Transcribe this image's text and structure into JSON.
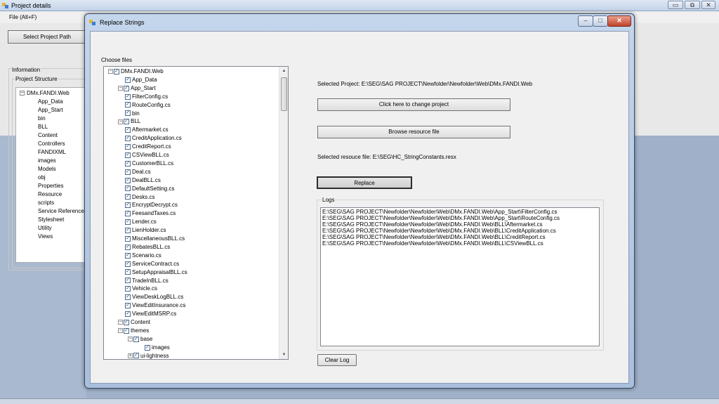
{
  "background_window": {
    "title": "Project details",
    "menu": "File (Alt+F)",
    "caption_buttons": {
      "minimize": "▭",
      "restore": "⧉",
      "close": "✕"
    },
    "select_path_label": "Select Project Path",
    "information_label": "Information",
    "project_structure_label": "Project Structure",
    "tree_root": "DMx.FANDI.Web",
    "tree_items": [
      "App_Data",
      "App_Start",
      "bin",
      "BLL",
      "Content",
      "Controllers",
      "FANDIXML",
      "images",
      "Models",
      "obj",
      "Properties",
      "Resource",
      "scripts",
      "Service Reference",
      "Stylesheet",
      "Utility",
      "Views"
    ]
  },
  "dialog": {
    "title": "Replace Strings",
    "caption_buttons": {
      "minimize": "‒",
      "maximize": "□",
      "close": "✕"
    },
    "choose_files_label": "Choose files",
    "file_tree": [
      {
        "label": "DMx.FANDI.Web",
        "level": 0,
        "expander": "−",
        "checked": true
      },
      {
        "label": "App_Data",
        "level": 1,
        "expander": "",
        "checked": true
      },
      {
        "label": "App_Start",
        "level": 1,
        "expander": "−",
        "checked": true
      },
      {
        "label": "FilterConfig.cs",
        "level": 2,
        "expander": "",
        "checked": true
      },
      {
        "label": "RouteConfig.cs",
        "level": 2,
        "expander": "",
        "checked": true
      },
      {
        "label": "bin",
        "level": 1,
        "expander": "",
        "checked": true
      },
      {
        "label": "BLL",
        "level": 1,
        "expander": "−",
        "checked": true
      },
      {
        "label": "Aftermarket.cs",
        "level": 2,
        "expander": "",
        "checked": true
      },
      {
        "label": "CreditApplication.cs",
        "level": 2,
        "expander": "",
        "checked": true
      },
      {
        "label": "CreditReport.cs",
        "level": 2,
        "expander": "",
        "checked": true
      },
      {
        "label": "CSViewBLL.cs",
        "level": 2,
        "expander": "",
        "checked": true
      },
      {
        "label": "CustomerBLL.cs",
        "level": 2,
        "expander": "",
        "checked": true
      },
      {
        "label": "Deal.cs",
        "level": 2,
        "expander": "",
        "checked": true
      },
      {
        "label": "DealBLL.cs",
        "level": 2,
        "expander": "",
        "checked": true
      },
      {
        "label": "DefaultSetting.cs",
        "level": 2,
        "expander": "",
        "checked": true
      },
      {
        "label": "Desks.cs",
        "level": 2,
        "expander": "",
        "checked": true
      },
      {
        "label": "EncryptDecrypt.cs",
        "level": 2,
        "expander": "",
        "checked": true
      },
      {
        "label": "FeesandTaxes.cs",
        "level": 2,
        "expander": "",
        "checked": true
      },
      {
        "label": "Lender.cs",
        "level": 2,
        "expander": "",
        "checked": true
      },
      {
        "label": "LienHolder.cs",
        "level": 2,
        "expander": "",
        "checked": true
      },
      {
        "label": "MiscellaneousBLL.cs",
        "level": 2,
        "expander": "",
        "checked": true
      },
      {
        "label": "RebatesBLL.cs",
        "level": 2,
        "expander": "",
        "checked": true
      },
      {
        "label": "Scenario.cs",
        "level": 2,
        "expander": "",
        "checked": true
      },
      {
        "label": "ServiceContract.cs",
        "level": 2,
        "expander": "",
        "checked": true
      },
      {
        "label": "SetupAppraisalBLL.cs",
        "level": 2,
        "expander": "",
        "checked": true
      },
      {
        "label": "TradeInBLL.cs",
        "level": 2,
        "expander": "",
        "checked": true
      },
      {
        "label": "Vehicle.cs",
        "level": 2,
        "expander": "",
        "checked": true
      },
      {
        "label": "ViewDeskLogBLL.cs",
        "level": 2,
        "expander": "",
        "checked": true
      },
      {
        "label": "ViewEditInsurance.cs",
        "level": 2,
        "expander": "",
        "checked": true
      },
      {
        "label": "ViewEditMSRP.cs",
        "level": 2,
        "expander": "",
        "checked": true
      },
      {
        "label": "Content",
        "level": 1,
        "expander": "−",
        "checked": true
      },
      {
        "label": "themes",
        "level": 2,
        "expander": "−",
        "checked": true
      },
      {
        "label": "base",
        "level": 3,
        "expander": "−",
        "checked": true
      },
      {
        "label": "images",
        "level": 4,
        "expander": "",
        "checked": true
      },
      {
        "label": "ui-lightness",
        "level": 3,
        "expander": "+",
        "checked": true
      }
    ],
    "selected_project_text": "Selected Project: E:\\SEG\\SAG PROJECT\\Newfolder\\Newfolder\\Web\\DMx.FANDI.Web",
    "change_project_label": "Click here to change project",
    "browse_resource_label": "Browse resource file",
    "selected_resource_text": "Selected resouce file: E:\\SEG\\HC_StringConstants.resx",
    "replace_label": "Replace",
    "logs_label": "Logs",
    "log_lines": [
      "E:\\SEG\\SAG PROJECT\\Newfolder\\Newfolder\\Web\\DMx.FANDI.Web\\App_Start\\FilterConfig.cs",
      "E:\\SEG\\SAG PROJECT\\Newfolder\\Newfolder\\Web\\DMx.FANDI.Web\\App_Start\\RouteConfig.cs",
      "E:\\SEG\\SAG PROJECT\\Newfolder\\Newfolder\\Web\\DMx.FANDI.Web\\BLL\\Aftermarket.cs",
      "E:\\SEG\\SAG PROJECT\\Newfolder\\Newfolder\\Web\\DMx.FANDI.Web\\BLL\\CreditApplication.cs",
      "E:\\SEG\\SAG PROJECT\\Newfolder\\Newfolder\\Web\\DMx.FANDI.Web\\BLL\\CreditReport.cs",
      "E:\\SEG\\SAG PROJECT\\Newfolder\\Newfolder\\Web\\DMx.FANDI.Web\\BLL\\CSViewBLL.cs"
    ],
    "clear_log_label": "Clear Log"
  },
  "colors": {
    "dialog_frame": "#b4c8e2",
    "client": "#f0f0f0",
    "close_button": "#c2412a"
  },
  "icons": {
    "app": "window-app-icon",
    "tree_scroll_up": "▲",
    "tree_scroll_down": "▼",
    "check": "✓"
  }
}
